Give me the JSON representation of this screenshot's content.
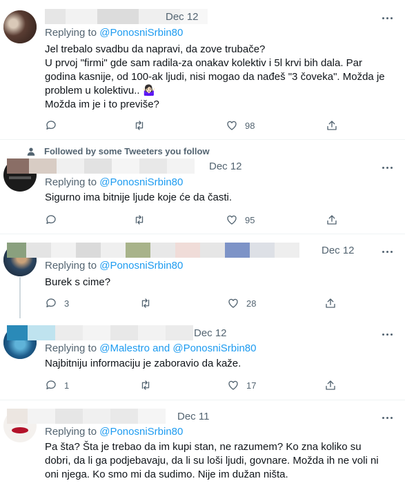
{
  "colors": {
    "link": "#1d9bf0",
    "muted": "#536471",
    "text": "#0f1419"
  },
  "reply_prefix": "Replying to",
  "followed_banner": "Followed by some Tweeters you follow",
  "tweets": [
    {
      "date": "Dec 12",
      "replying_to": "@PonosniSrbin80",
      "text": "Jel trebalo svadbu da napravi, da zove trubače?\nU prvoj \"firmi\" gde sam radila-za onakav kolektiv i 5l krvi bih dala. Par godina kasnije, od 100-ak ljudi, nisi mogao da nađeš \"3 čoveka\". Možda je problem u kolektivu.. 🤷🏻‍♀️\nMožda im je i to previše?",
      "replies": "",
      "retweets": "",
      "likes": "98"
    },
    {
      "date": "Dec 12",
      "replying_to": "@PonosniSrbin80",
      "text": "Sigurno ima bitnije ljude koje će da časti.",
      "replies": "",
      "retweets": "",
      "likes": "95"
    },
    {
      "date": "Dec 12",
      "replying_to": "@PonosniSrbin80",
      "text": "Burek s cime?",
      "replies": "3",
      "retweets": "",
      "likes": "28"
    },
    {
      "date": "Dec 12",
      "replying_to_a": "@Malestro",
      "and": "and",
      "replying_to_b": "@PonosniSrbin80",
      "text": "Najbitniju informaciju je zaboravio da kaže.",
      "replies": "1",
      "retweets": "",
      "likes": "17"
    },
    {
      "date": "Dec 11",
      "replying_to": "@PonosniSrbin80",
      "text": "Pa šta? Šta je trebao da im kupi stan, ne razumem? Ko zna koliko su dobri, da li ga podjebavaju, da li su loši ljudi, govnare. Možda ih ne voli ni oni njega. Ko smo mi da sudimo. Nije im dužan ništa."
    }
  ]
}
